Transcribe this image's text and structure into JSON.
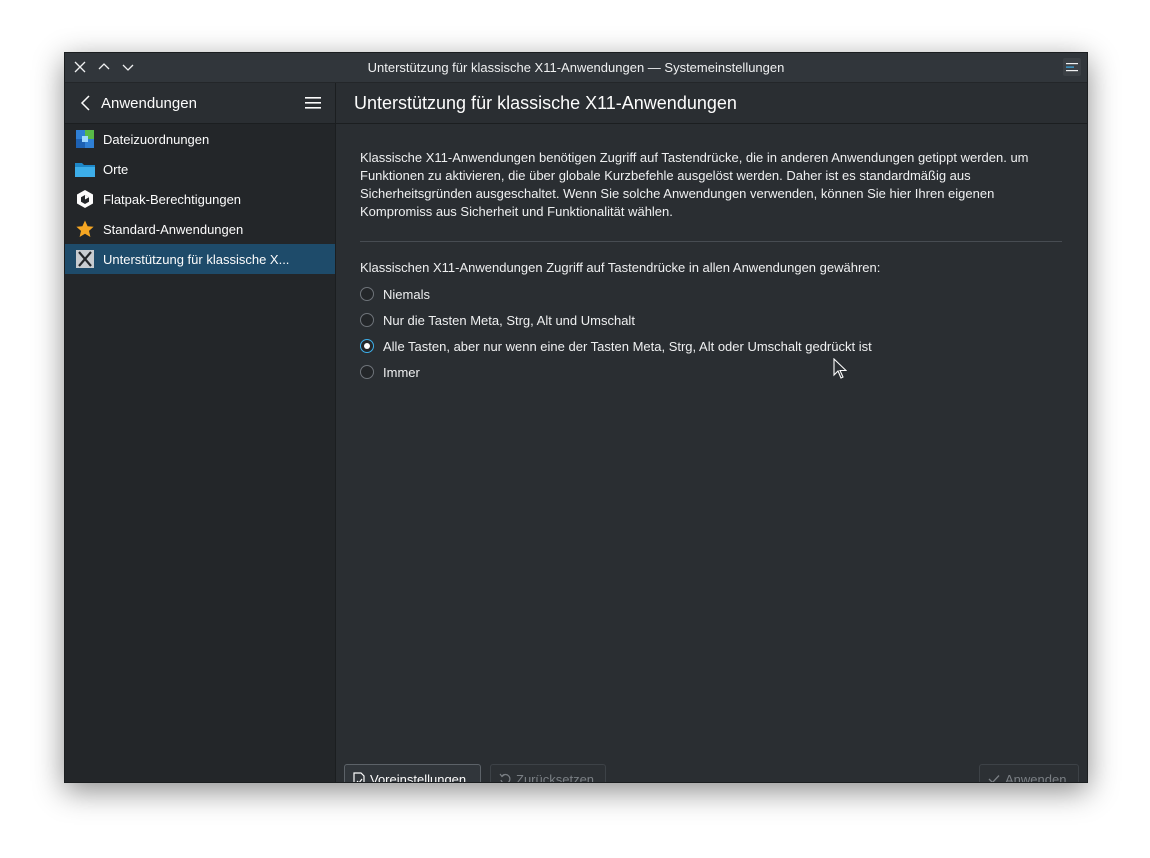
{
  "window": {
    "title": "Unterstützung für klassische X11-Anwendungen — Systemeinstellungen"
  },
  "sidebar": {
    "title": "Anwendungen",
    "items": [
      {
        "label": "Dateizuordnungen",
        "icon": "file-associations-icon"
      },
      {
        "label": "Orte",
        "icon": "folder-icon"
      },
      {
        "label": "Flatpak-Berechtigungen",
        "icon": "flatpak-icon"
      },
      {
        "label": "Standard-Anwendungen",
        "icon": "star-icon"
      },
      {
        "label": "Unterstützung für klassische X...",
        "icon": "x11-icon",
        "active": true
      }
    ]
  },
  "main": {
    "title": "Unterstützung für klassische X11-Anwendungen",
    "description": "Klassische X11-Anwendungen benötigen Zugriff auf Tastendrücke, die in anderen Anwendungen getippt werden. um Funktionen zu aktivieren, die über globale Kurzbefehle ausgelöst werden. Daher ist es standardmäßig aus Sicherheitsgründen ausgeschaltet. Wenn Sie solche Anwendungen verwenden, können Sie hier Ihren eigenen Kompromiss aus Sicherheit und Funktionalität wählen.",
    "question": "Klassischen X11-Anwendungen Zugriff auf Tastendrücke in allen Anwendungen gewähren:",
    "options": [
      {
        "label": "Niemals",
        "checked": false
      },
      {
        "label": "Nur die Tasten Meta, Strg, Alt und Umschalt",
        "checked": false
      },
      {
        "label": "Alle Tasten, aber nur wenn eine der Tasten Meta, Strg, Alt oder Umschalt gedrückt ist",
        "checked": true
      },
      {
        "label": "Immer",
        "checked": false
      }
    ]
  },
  "footer": {
    "defaults_label": "Voreinstellungen",
    "reset_label": "Zurücksetzen",
    "apply_label": "Anwenden"
  },
  "colors": {
    "accent": "#3daee9",
    "selection": "#1e4b6a",
    "background": "#2a2e32",
    "sidebar": "#232629"
  }
}
